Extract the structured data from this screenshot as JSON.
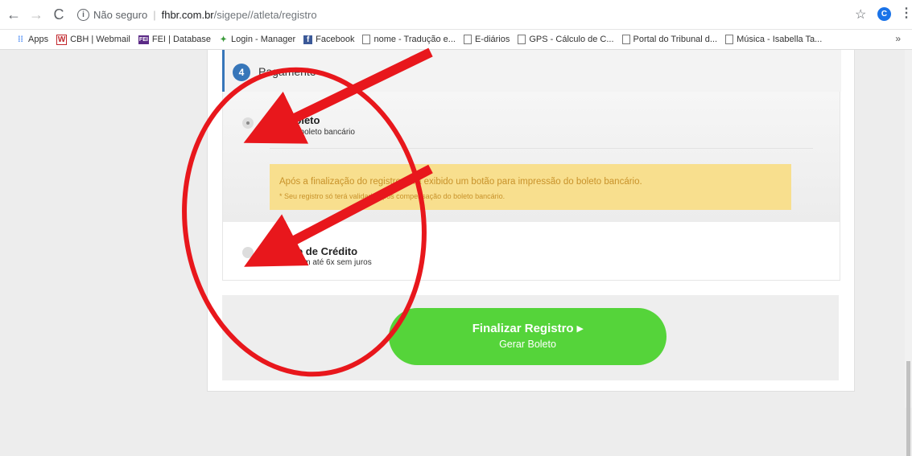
{
  "browser": {
    "security_label": "Não seguro",
    "url_host": "fhbr.com.br",
    "url_path": "/sigepe//atleta/registro",
    "profile_initial": "C",
    "bookmarks": [
      {
        "label": "Apps",
        "icon": "apps-grid-icon",
        "color": "#4285f4"
      },
      {
        "label": "CBH | Webmail",
        "icon": "w-logo-icon",
        "color": "#c1272d"
      },
      {
        "label": "FEI | Database",
        "icon": "fei-logo-icon",
        "color": "#5b2a86"
      },
      {
        "label": "Login - Manager",
        "icon": "manager-logo-icon",
        "color": "#3a9a3a"
      },
      {
        "label": "Facebook",
        "icon": "facebook-icon",
        "color": "#3b5998"
      },
      {
        "label": "nome - Tradução e...",
        "icon": "page-icon",
        "color": "#777"
      },
      {
        "label": "E-diários",
        "icon": "page-icon",
        "color": "#777"
      },
      {
        "label": "GPS - Cálculo de C...",
        "icon": "page-icon",
        "color": "#777"
      },
      {
        "label": "Portal do Tribunal d...",
        "icon": "page-icon",
        "color": "#777"
      },
      {
        "label": "Música - Isabella Ta...",
        "icon": "page-icon",
        "color": "#777"
      }
    ],
    "more_label": "»"
  },
  "step": {
    "number": "4",
    "title": "Pagamento"
  },
  "payment": {
    "boleto": {
      "title": "Boleto",
      "desc": "via boleto bancário",
      "notice_line1": "Após a finalização do registro será exibido um botão para impressão do boleto bancário.",
      "notice_line2": "* Seu registro só terá validade após compensação do boleto bancário."
    },
    "card": {
      "title": "Cartão de Crédito",
      "desc": "Parcele em até 6x sem juros"
    }
  },
  "submit": {
    "main_label": "Finalizar Registro ▸",
    "sub_label": "Gerar Boleto"
  },
  "colors": {
    "accent": "#3776b9",
    "button": "#55d43a",
    "notice_bg": "#f8df8e",
    "annotation": "#e8171c"
  }
}
